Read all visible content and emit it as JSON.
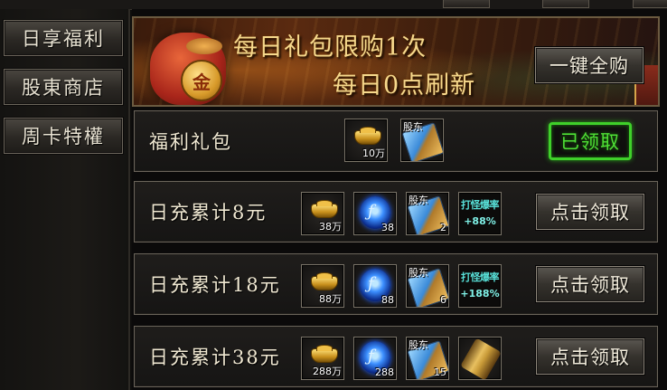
{
  "sidebar": {
    "items": [
      {
        "label": "日享福利"
      },
      {
        "label": "股東商店"
      },
      {
        "label": "周卡特權"
      }
    ]
  },
  "banner": {
    "line1": "每日礼包限购1次",
    "line2": "每日0点刷新",
    "buy_all_label": "一键全购",
    "coin_glyph": "金"
  },
  "rows": [
    {
      "title": "福利礼包",
      "items": [
        {
          "icon": "gold-ingot-icon",
          "count": "10万"
        },
        {
          "icon": "shareholder-scroll-icon",
          "tag": "股东",
          "count": ""
        }
      ],
      "status": "已领取"
    },
    {
      "title": "日充累计8元",
      "items": [
        {
          "icon": "gold-ingot-icon",
          "count": "38万"
        },
        {
          "icon": "blue-orb-icon",
          "count": "38"
        },
        {
          "icon": "shareholder-scroll-icon",
          "tag": "股东",
          "count": "2"
        },
        {
          "icon": "drop-rate-buff",
          "line1": "打怪爆率",
          "line2": "+88%"
        }
      ],
      "button": "点击领取"
    },
    {
      "title": "日充累计18元",
      "items": [
        {
          "icon": "gold-ingot-icon",
          "count": "88万"
        },
        {
          "icon": "blue-orb-icon",
          "count": "88"
        },
        {
          "icon": "shareholder-scroll-icon",
          "tag": "股东",
          "count": "6"
        },
        {
          "icon": "drop-rate-buff",
          "line1": "打怪爆率",
          "line2": "+188%"
        }
      ],
      "button": "点击领取"
    },
    {
      "title": "日充累计38元",
      "items": [
        {
          "icon": "gold-ingot-icon",
          "count": "288万"
        },
        {
          "icon": "blue-orb-icon",
          "count": "288"
        },
        {
          "icon": "shareholder-scroll-icon",
          "tag": "股东",
          "count": "15"
        },
        {
          "icon": "golden-scroll-icon"
        }
      ],
      "button": "点击领取"
    }
  ],
  "colors": {
    "accent_gold": "#f6d98c",
    "claimed_green": "#4fe036",
    "buff_cyan": "#58e0d8"
  }
}
